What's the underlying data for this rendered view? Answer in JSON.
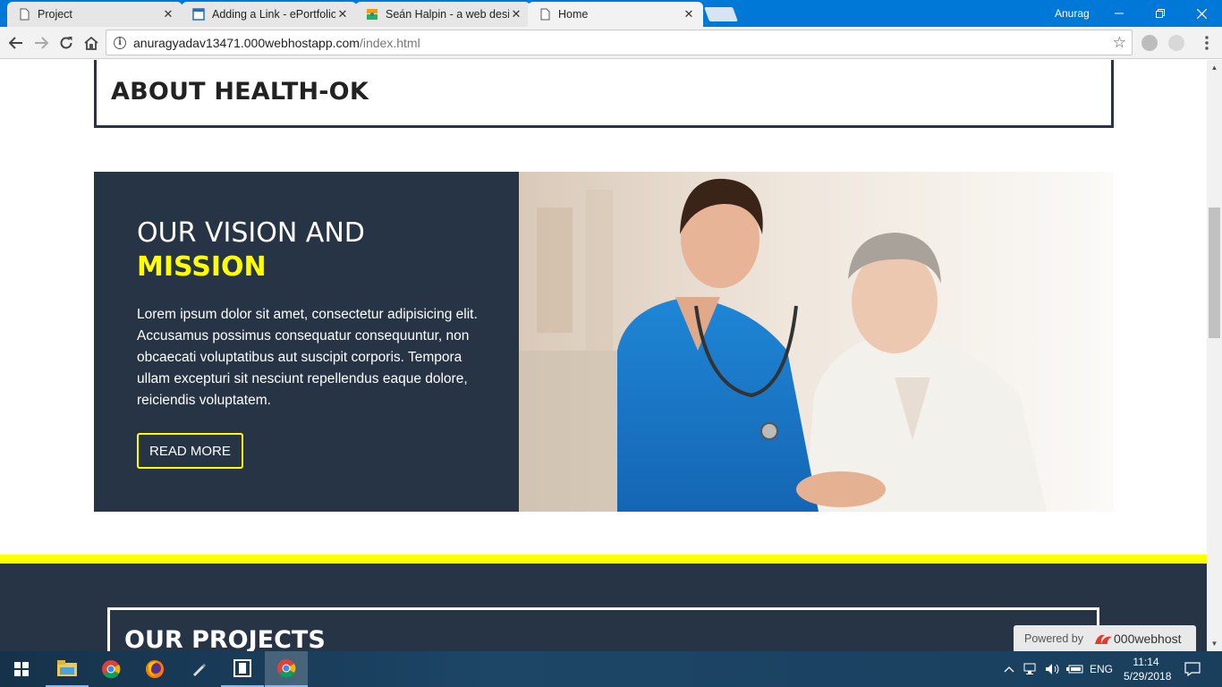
{
  "browser": {
    "tabs": [
      {
        "title": "Project",
        "icon": "page-icon",
        "active": false
      },
      {
        "title": "Adding a Link - ePortfolio",
        "icon": "eportfolio-icon",
        "active": false
      },
      {
        "title": "Seán Halpin - a web desi",
        "icon": "site-icon",
        "active": false
      },
      {
        "title": "Home",
        "icon": "page-icon",
        "active": true
      }
    ],
    "profile_name": "Anurag",
    "url_host": "anuragyadav13471.000webhostapp.com",
    "url_path": "/index.html"
  },
  "page": {
    "about_title": "ABOUT HEALTH-OK",
    "vision_title_line1": "OUR VISION AND",
    "vision_title_line2": "MISSION",
    "vision_text": "Lorem ipsum dolor sit amet, consectetur adipisicing elit. Accusamus possimus consequatur consequuntur, non obcaecati voluptatibus aut suscipit corporis. Tempora ullam excepturi sit nesciunt repellendus eaque dolore, reiciendis voluptatem.",
    "read_more_label": "READ MORE",
    "projects_title": "OUR PROJECTS",
    "powered_by_label": "Powered by",
    "powered_by_brand": "000webhost",
    "colors": {
      "navy": "#263445",
      "accent": "#ffff00"
    }
  },
  "taskbar": {
    "language": "ENG",
    "time": "11:14",
    "date": "5/29/2018"
  }
}
